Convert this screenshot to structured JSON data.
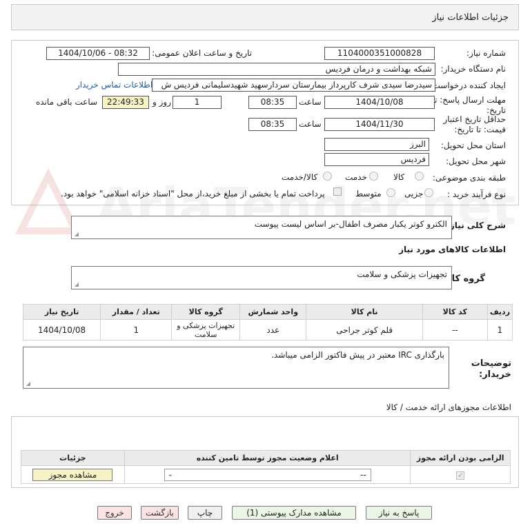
{
  "page_title": "جزئیات اطلاعات نیاز",
  "fields": {
    "need_number_label": "شماره نیاز:",
    "need_number": "1104000351000828",
    "announce_label": "تاریخ و ساعت اعلان عمومی:",
    "announce_value": "1404/10/06 - 08:32",
    "buyer_org_label": "نام دستگاه خریدار:",
    "buyer_org": "شبکه بهداشت و درمان فردیس",
    "requester_label": "ایجاد کننده درخواست:",
    "requester": "سیدرضا سیدی شرف کارپرداز بیمارستان سردارسهید شهیدسلیمانی فردیس ش",
    "contact_link": "اطلاعات تماس خریدار",
    "deadline_label_1": "مهلت ارسال پاسخ: تا",
    "deadline_label_2": "تاریخ:",
    "deadline_date": "1404/10/08",
    "time_label": "ساعت",
    "deadline_time": "08:35",
    "days_value": "1",
    "days_label": "روز و",
    "remaining_time": "22:49:33",
    "remaining_label": "ساعت باقی مانده",
    "validity_label_1": "حداقل تاریخ اعتبار",
    "validity_label_2": "قیمت: تا تاریخ:",
    "validity_date": "1404/11/30",
    "validity_time": "08:35",
    "province_label": "استان محل تحویل:",
    "province": "البرز",
    "city_label": "شهر محل تحویل:",
    "city": "فردیس",
    "category_label": "طبقه بندی موضوعی:",
    "category_options": [
      "کالا",
      "خدمت",
      "کالا/خدمت"
    ],
    "process_label": "نوع فرآیند خرید :",
    "process_options": [
      "جزیی",
      "متوسط"
    ],
    "payment_note": "پرداخت تمام یا بخشی از مبلغ خرید،از محل \"اسناد خزانه اسلامی\" خواهد بود."
  },
  "description": {
    "label": "شرح کلی نیاز:",
    "value": "الکترو کوتر یکبار مصرف اطفال-بر اساس لیست پیوست"
  },
  "goods_section_title": "اطلاعات کالاهای مورد نیاز",
  "goods_group": {
    "label": "گروه کالا:",
    "value": "تجهیزات پزشکی و سلامت"
  },
  "goods_table": {
    "headers": [
      "ردیف",
      "کد کالا",
      "نام کالا",
      "واحد شمارش",
      "گروه کالا",
      "تعداد / مقدار",
      "تاریخ نیاز"
    ],
    "rows": [
      [
        "1",
        "--",
        "قلم کوتر جراحی",
        "عدد",
        "تجهیزات پزشکی و سلامت",
        "1",
        "1404/10/08"
      ]
    ]
  },
  "buyer_notes": {
    "label_1": "توضیحات",
    "label_2": "خریدار:",
    "value": "بارگذاری IRC معتبر در پیش فاکتور الزامی میباشد."
  },
  "permits": {
    "title": "اطلاعات مجوزهای ارائه خدمت / کالا",
    "headers": [
      "الزامی بودن ارائه مجوز",
      "اعلام وضعیت مجوز توسط تامین کننده",
      "جزئیات"
    ],
    "select_value": "--",
    "view_button": "مشاهده مجوز"
  },
  "footer_buttons": {
    "reply": "پاسخ به نیاز",
    "view_docs": "مشاهده مدارک پیوستی (1)",
    "print": "چاپ",
    "back": "بازگشت",
    "exit": "خروج"
  },
  "watermark_text": "AriaTender.net",
  "colors": {
    "accent_link": "#1b5fb0",
    "remaining_bg": "#f7f3c6",
    "green_btn": "#ebf5e6",
    "pink_btn": "#fbe3e3"
  }
}
